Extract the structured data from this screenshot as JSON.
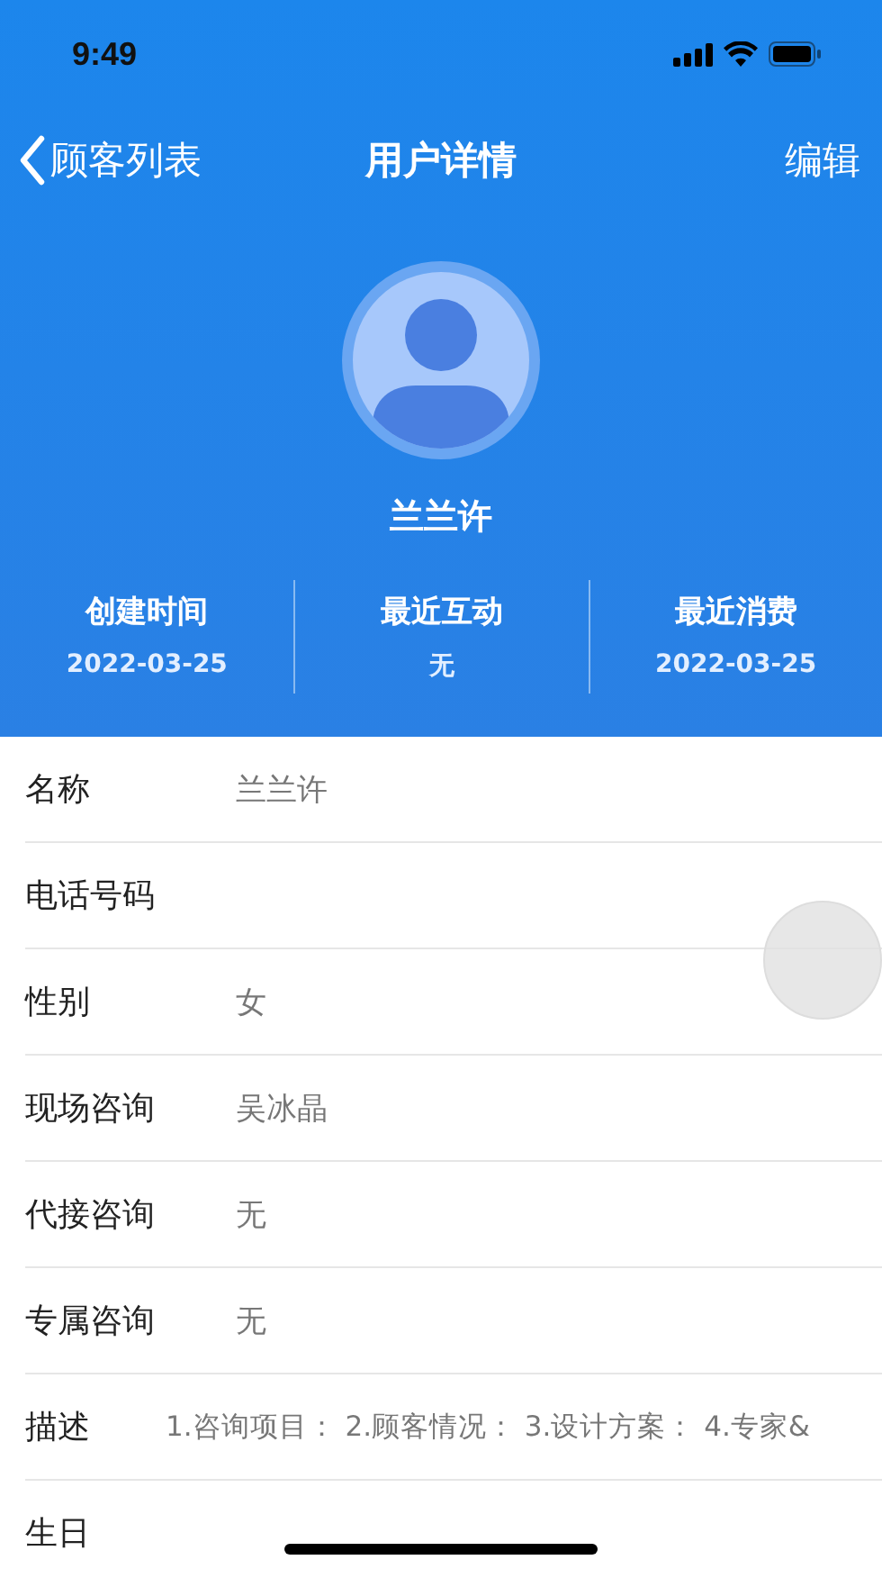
{
  "status_bar": {
    "time": "9:49"
  },
  "nav": {
    "back": "顾客列表",
    "title": "用户详情",
    "action": "编辑"
  },
  "profile": {
    "name": "兰兰许"
  },
  "stats": [
    {
      "label": "创建时间",
      "value": "2022-03-25"
    },
    {
      "label": "最近互动",
      "value": "无"
    },
    {
      "label": "最近消费",
      "value": "2022-03-25"
    }
  ],
  "fields": [
    {
      "label": "名称",
      "value": "兰兰许"
    },
    {
      "label": "电话号码"
    },
    {
      "label": "性别",
      "value": "女"
    },
    {
      "label": "现场咨询",
      "value": "吴冰晶"
    },
    {
      "label": "代接咨询",
      "value": "无"
    },
    {
      "label": "专属咨询",
      "value": "无"
    },
    {
      "label": "描述",
      "value": "1.咨询项目： 2.顾客情况： 3.设计方案： 4.专家&",
      "kind": "long"
    },
    {
      "label": "生日"
    }
  ]
}
